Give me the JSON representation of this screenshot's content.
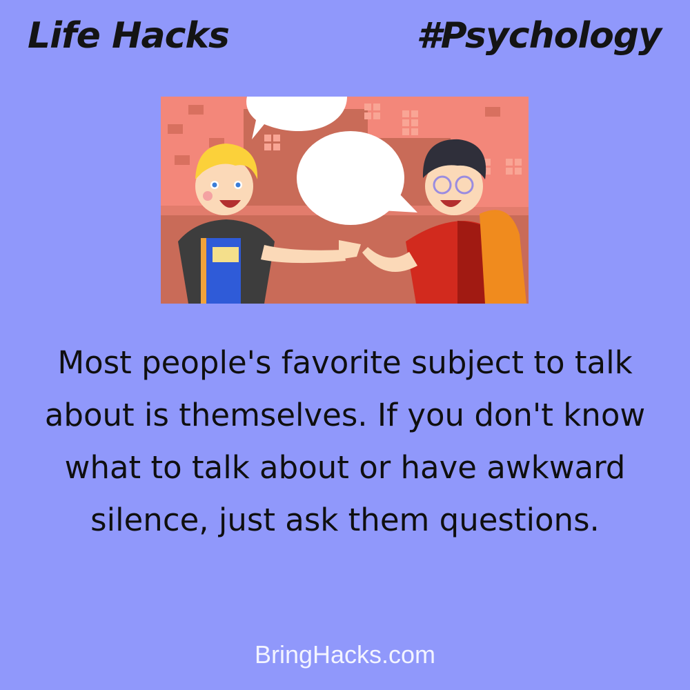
{
  "header": {
    "title": "Life Hacks",
    "hashtag": "#Psychology"
  },
  "illustration": {
    "icon": "two-people-talking-illustration",
    "colors": {
      "background": "#c96b58",
      "building": "#f58a78",
      "speech_bubble": "#ffffff"
    }
  },
  "body": {
    "text": "Most people's favorite subject to talk about is themselves. If you don't know what to talk about or have awkward silence, just ask them questions."
  },
  "footer": {
    "site": "BringHacks.com"
  }
}
